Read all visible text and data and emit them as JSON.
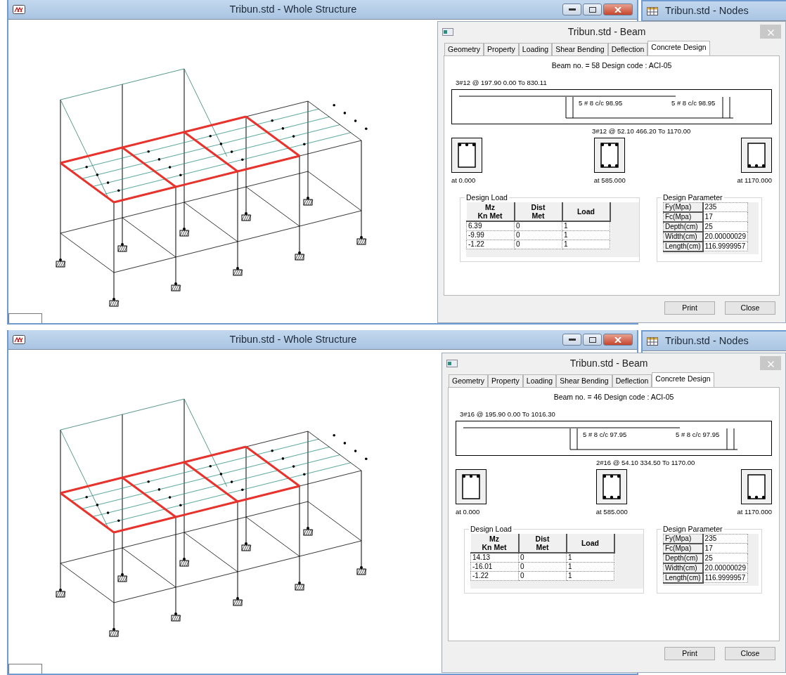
{
  "screens": [
    {
      "main_window": {
        "title": "Tribun.std - Whole Structure"
      },
      "nodes_window": {
        "title": "Tribun.std - Nodes"
      },
      "beam_dialog": {
        "title": "Tribun.std - Beam",
        "tabs": [
          {
            "label": "Geometry",
            "selected": false
          },
          {
            "label": "Property",
            "selected": false
          },
          {
            "label": "Loading",
            "selected": false
          },
          {
            "label": "Shear Bending",
            "selected": false
          },
          {
            "label": "Deflection",
            "selected": false
          },
          {
            "label": "Concrete Design",
            "selected": true
          }
        ],
        "summary": "Beam no. = 58  Design code :  ACI-05",
        "top_rebar": "3#12 @ 197.90 0.00 To 830.11",
        "stirrups": [
          "5 # 8 c/c 98.95",
          "5 # 8 c/c 98.95"
        ],
        "bottom_rebar": "3#12 @ 52.10 466.20 To 1170.00",
        "sections": [
          {
            "label": "at 0.000",
            "kind": "top"
          },
          {
            "label": "at 585.000",
            "kind": "both"
          },
          {
            "label": "at 1170.000",
            "kind": "bottom"
          }
        ],
        "design_load": {
          "title": "Design Load",
          "columns": [
            "Mz\nKn Met",
            "Dist\nMet",
            "Load"
          ],
          "rows": [
            [
              "6.39",
              "0",
              "1"
            ],
            [
              "-9.99",
              "0",
              "1"
            ],
            [
              "-1.22",
              "0",
              "1"
            ]
          ]
        },
        "design_parameter": {
          "title": "Design Parameter",
          "rows": [
            [
              "Fy(Mpa)",
              "235"
            ],
            [
              "Fc(Mpa)",
              "17"
            ],
            [
              "Depth(cm)",
              "25"
            ],
            [
              "Width(cm)",
              "20.00000029"
            ],
            [
              "Length(cm)",
              "116.9999957"
            ]
          ]
        },
        "buttons": [
          "Print",
          "Close"
        ]
      }
    },
    {
      "main_window": {
        "title": "Tribun.std - Whole Structure"
      },
      "nodes_window": {
        "title": "Tribun.std - Nodes"
      },
      "beam_dialog": {
        "title": "Tribun.std - Beam",
        "tabs": [
          {
            "label": "Geometry",
            "selected": false
          },
          {
            "label": "Property",
            "selected": false
          },
          {
            "label": "Loading",
            "selected": false
          },
          {
            "label": "Shear Bending",
            "selected": false
          },
          {
            "label": "Deflection",
            "selected": false
          },
          {
            "label": "Concrete Design",
            "selected": true
          }
        ],
        "summary": "Beam no. = 46  Design code :  ACI-05",
        "top_rebar": "3#16 @ 195.90 0.00 To 1016.30",
        "stirrups": [
          "5 # 8 c/c 97.95",
          "5 # 8 c/c 97.95"
        ],
        "bottom_rebar": "2#16 @ 54.10 334.50 To 1170.00",
        "sections": [
          {
            "label": "at 0.000",
            "kind": "top"
          },
          {
            "label": "at 585.000",
            "kind": "both"
          },
          {
            "label": "at 1170.000",
            "kind": "bottom"
          }
        ],
        "design_load": {
          "title": "Design Load",
          "columns": [
            "Mz\nKn Met",
            "Dist\nMet",
            "Load"
          ],
          "rows": [
            [
              "14.13",
              "0",
              "1"
            ],
            [
              "-16.01",
              "0",
              "1"
            ],
            [
              "-1.22",
              "0",
              "1"
            ]
          ]
        },
        "design_parameter": {
          "title": "Design Parameter",
          "rows": [
            [
              "Fy(Mpa)",
              "235"
            ],
            [
              "Fc(Mpa)",
              "17"
            ],
            [
              "Depth(cm)",
              "25"
            ],
            [
              "Width(cm)",
              "20.00000029"
            ],
            [
              "Length(cm)",
              "116.9999957"
            ]
          ]
        },
        "buttons": [
          "Print",
          "Close"
        ]
      }
    }
  ]
}
